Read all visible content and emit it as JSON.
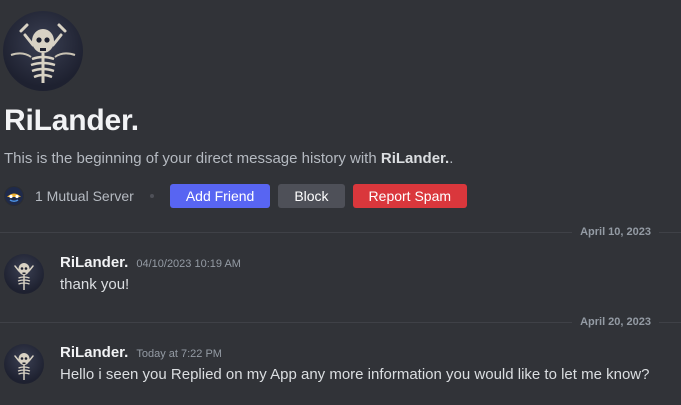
{
  "intro": {
    "name": "RiLander.",
    "description_prefix": "This is the beginning of your direct message history with ",
    "description_name": "RiLander.",
    "description_suffix": ".",
    "mutual_servers": "1 Mutual Server",
    "add_friend_label": "Add Friend",
    "block_label": "Block",
    "report_spam_label": "Report Spam"
  },
  "colors": {
    "background": "#313338",
    "add_friend": "#5865f2",
    "block": "#4e5058",
    "report_spam": "#da373c"
  },
  "messages": [
    {
      "date_divider": "April 10, 2023",
      "author": "RiLander.",
      "timestamp": "04/10/2023 10:19 AM",
      "text": "thank you!"
    },
    {
      "date_divider": "April 20, 2023",
      "author": "RiLander.",
      "timestamp": "Today at 7:22 PM",
      "text": "Hello i seen you Replied on my App any more information you would like to let me know?"
    }
  ]
}
